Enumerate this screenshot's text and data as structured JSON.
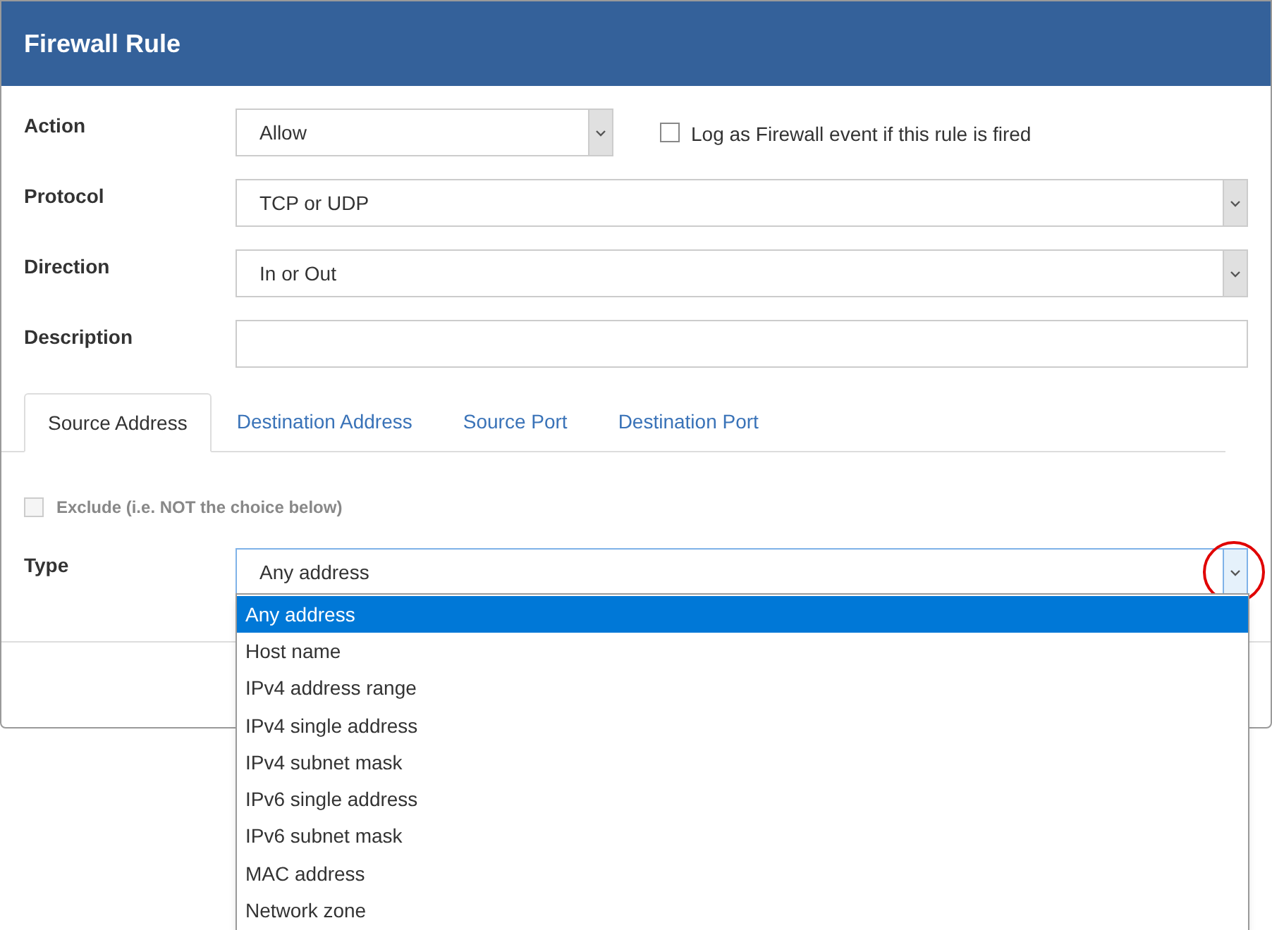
{
  "dialog": {
    "title": "Firewall Rule"
  },
  "fields": [
    {
      "kind": "select",
      "label": "Action",
      "value": "Allow",
      "log_option": {
        "label": "Log as Firewall event if this rule is fired",
        "checked": false
      }
    },
    {
      "kind": "select",
      "label": "Protocol",
      "value": "TCP or UDP"
    },
    {
      "kind": "select",
      "label": "Direction",
      "value": "In or Out"
    },
    {
      "kind": "text",
      "label": "Description"
    }
  ],
  "tabs": [
    {
      "label": "Source Address",
      "selected": true
    },
    {
      "label": "Destination Address",
      "selected": false
    },
    {
      "label": "Source Port",
      "selected": false
    },
    {
      "label": "Destination Port",
      "selected": false
    }
  ],
  "exclude": {
    "label": "Exclude (i.e. NOT the choice below)",
    "checked": false,
    "disabled": true
  },
  "type_field": {
    "label": "Type",
    "value": "Any address",
    "expanded": true,
    "options": [
      {
        "label": "Any address",
        "selected": true
      },
      {
        "label": "Host name",
        "selected": false
      },
      {
        "label": "IPv4 address range",
        "selected": false
      },
      {
        "label": "IPv4 single address",
        "selected": false
      },
      {
        "label": "IPv4 subnet mask",
        "selected": false
      },
      {
        "label": "IPv6 single address",
        "selected": false
      },
      {
        "label": "IPv6 subnet mask",
        "selected": false
      },
      {
        "label": "MAC address",
        "selected": false
      },
      {
        "label": "Network zone",
        "selected": false
      }
    ]
  }
}
